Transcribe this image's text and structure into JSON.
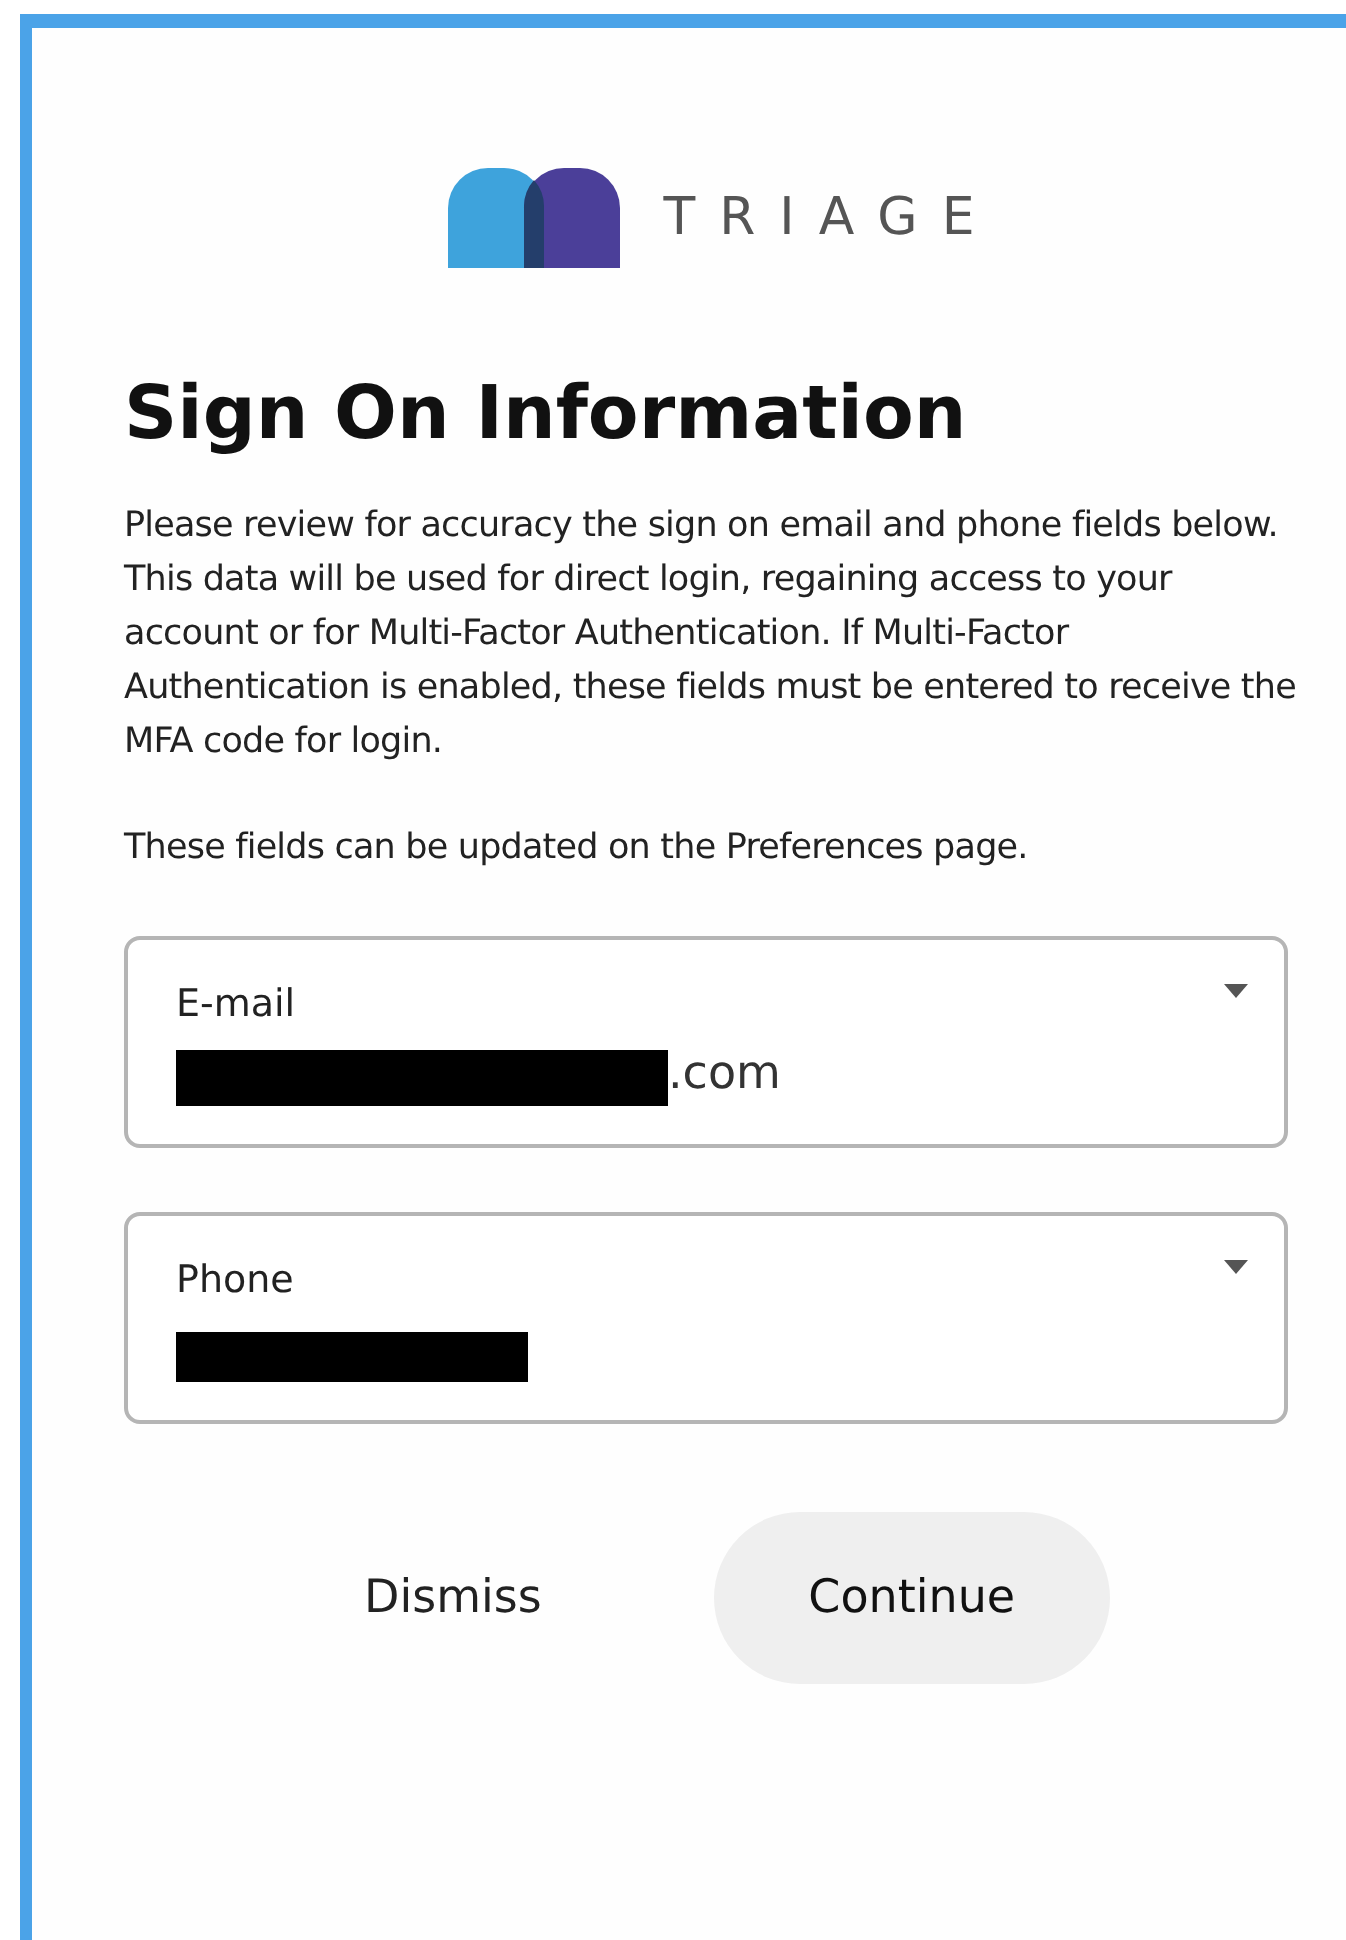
{
  "logo": {
    "text": "TRIAGE"
  },
  "title": "Sign On Information",
  "paragraphs": [
    "Please review for accuracy the sign on email and phone fields below. This data will be used for direct login, regaining access to your account or for Multi-Factor Authentication. If Multi-Factor Authentication is enabled, these fields must be entered to receive the MFA code for login.",
    "These fields can be updated on the Preferences page."
  ],
  "fields": [
    {
      "label": "E-mail",
      "redacted": true,
      "value": ".com"
    },
    {
      "label": "Phone",
      "redacted": true
    }
  ],
  "buttons": [
    {
      "label": "Dismiss",
      "kind": "text"
    },
    {
      "label": "Continue",
      "kind": "filled"
    }
  ]
}
